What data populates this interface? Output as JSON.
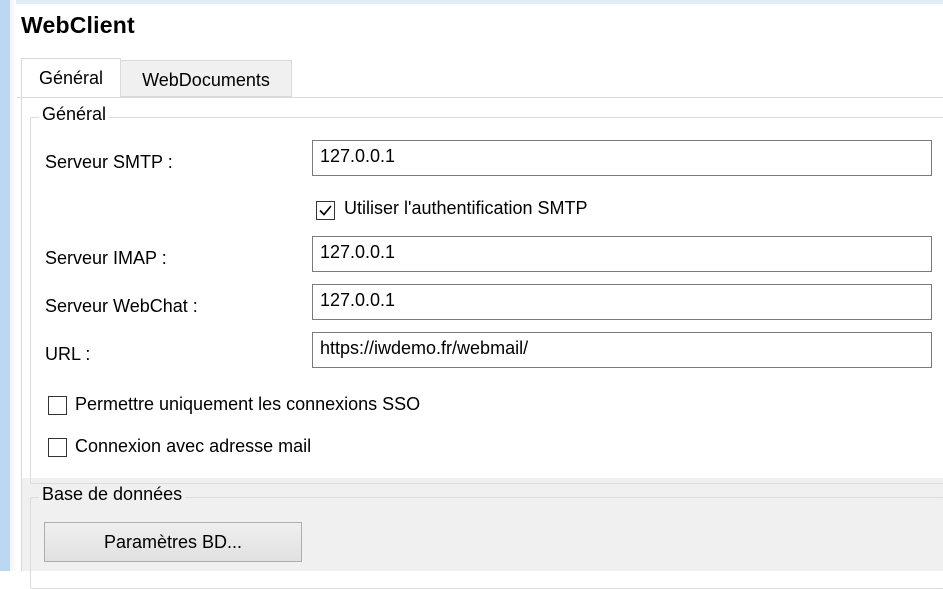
{
  "window": {
    "title": "WebClient"
  },
  "tabs": [
    {
      "label": "Général",
      "active": true
    },
    {
      "label": "WebDocuments",
      "active": false
    }
  ],
  "general_group": {
    "legend": "Général",
    "smtp": {
      "label": "Serveur SMTP :",
      "value": "127.0.0.1"
    },
    "smtp_auth": {
      "label": "Utiliser l'authentification SMTP",
      "checked": true
    },
    "imap": {
      "label": "Serveur IMAP :",
      "value": "127.0.0.1"
    },
    "webchat": {
      "label": "Serveur WebChat :",
      "value": "127.0.0.1"
    },
    "url": {
      "label": "URL :",
      "value": "https://iwdemo.fr/webmail/"
    },
    "sso_only": {
      "label": "Permettre uniquement les connexions SSO",
      "checked": false
    },
    "email_login": {
      "label": "Connexion avec adresse mail",
      "checked": false
    }
  },
  "database_group": {
    "legend": "Base de données",
    "button_label": "Paramètres BD..."
  },
  "colors": {
    "window_border": "#bcd7f2",
    "tab_inactive_bg": "#f0f0f0",
    "textbox_border": "#7a7a7a"
  }
}
